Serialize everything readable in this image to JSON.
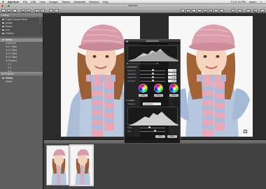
{
  "menubar": {
    "app": "Aperture",
    "items": [
      "File",
      "Edit",
      "View",
      "Images",
      "Stacks",
      "Metadata",
      "Window",
      "Help"
    ],
    "clock": "Fri 2:15 PM",
    "user": "Aaron"
  },
  "window": {
    "title": "Aperture"
  },
  "sidebar": {
    "header": "Library",
    "items": [
      {
        "label": "Project Library Folder",
        "count": "4"
      },
      {
        "label": "Library",
        "count": "1"
      },
      {
        "label": "Recent",
        "count": ""
      },
      {
        "label": "Lost",
        "count": ""
      },
      {
        "label": "Portfolio",
        "count": ""
      }
    ],
    "project_label": "Ashley",
    "albums": [
      "★★★★★",
      "★ 1+ Stars",
      "★ 2+ Stars",
      "★ 3+ Stars",
      "★ 4+ Stars",
      "★ Unrated",
      "1-2",
      "1-3",
      "1-4",
      "1-5",
      "Selects",
      "Select"
    ],
    "lower_header": "All Projects",
    "lower_item": "Ashley"
  },
  "hud": {
    "title": "Adjustments",
    "levels_label": "Levels",
    "exposure_label": "Exposure",
    "sliders": [
      {
        "label": "Exposure",
        "value": "0.0"
      },
      {
        "label": "Saturation",
        "value": "1.00"
      },
      {
        "label": "Brightness",
        "value": "0.00"
      },
      {
        "label": "Contrast",
        "value": "0.00"
      }
    ],
    "wb_label": "White Balance",
    "temp_label": "Temp",
    "tint_label": "Tint",
    "wb_buttons": [
      "Auto",
      "Reset",
      "Reset"
    ],
    "channel_label": "Channel",
    "channel_value": "Luminance",
    "levels_buttons": [
      "Auto",
      "Reset"
    ]
  },
  "colors": {
    "scarf_pink": "#e9a6b4",
    "scarf_blue": "#a9bcd8",
    "hat_pink": "#d99aa8",
    "jacket": "#b8c9dd",
    "hair": "#a0663a"
  }
}
